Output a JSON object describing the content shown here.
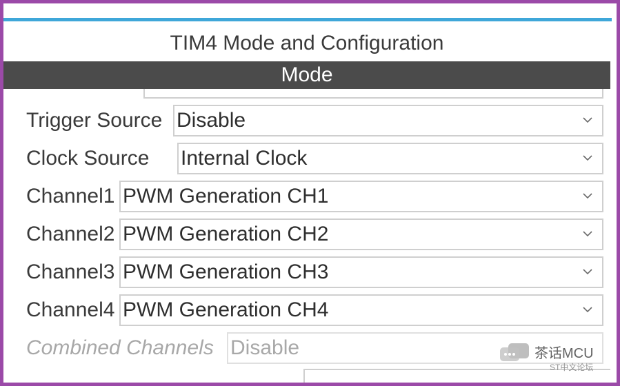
{
  "panel": {
    "title": "TIM4 Mode and Configuration",
    "section": "Mode"
  },
  "rows": [
    {
      "label": "Trigger Source",
      "value": "Disable",
      "enabled": true
    },
    {
      "label": "Clock Source",
      "value": "Internal Clock",
      "enabled": true
    },
    {
      "label": "Channel1",
      "value": "PWM Generation CH1",
      "enabled": true
    },
    {
      "label": "Channel2",
      "value": "PWM Generation CH2",
      "enabled": true
    },
    {
      "label": "Channel3",
      "value": "PWM Generation CH3",
      "enabled": true
    },
    {
      "label": "Channel4",
      "value": "PWM Generation CH4",
      "enabled": true
    },
    {
      "label": "Combined Channels",
      "value": "Disable",
      "enabled": false
    }
  ],
  "watermark": {
    "name": "茶话MCU",
    "sub": "ST中文论坛",
    "icon": "chat-bubble-icon"
  },
  "colors": {
    "frame": "#9b4aa8",
    "accent_rule": "#3fa7d9",
    "mode_bar": "#4b4b4b"
  }
}
